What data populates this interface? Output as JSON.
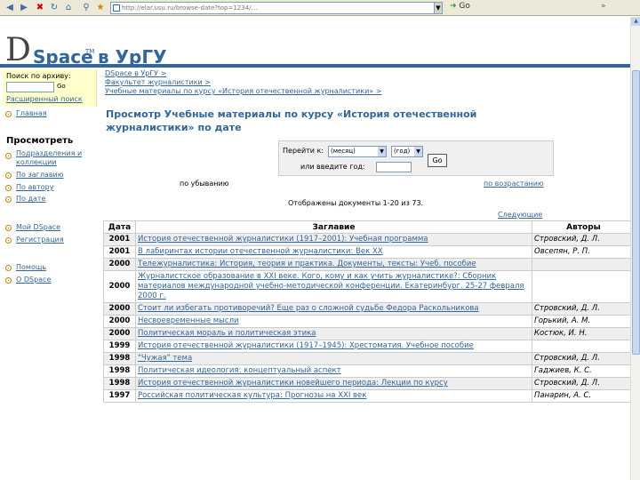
{
  "browser": {
    "address": "http://elar.usu.ru/browse-date?top=1234/…",
    "go_label": "Go"
  },
  "header": {
    "logo_d": "D",
    "logo_space": "Space",
    "logo_tm": "TM",
    "logo_suffix": "в УрГУ"
  },
  "sidebar": {
    "search_label": "Поиск по архиву:",
    "search_go": "Go",
    "advanced": "Расширенный поиск",
    "home": "Главная",
    "browse_heading": "Просмотреть",
    "browse_items": [
      "Подразделения и коллекции",
      "По заглавию",
      "По автору",
      "По дате"
    ],
    "my_items": [
      "Мой DSpace",
      "Регистрация"
    ],
    "help_items": [
      "Помощь",
      "О DSpace"
    ]
  },
  "main": {
    "crumbs": [
      "DSpace в УрГУ >",
      "Факультет журналистики >",
      "Учебные материалы по курсу «История отечественной журналистики» >"
    ],
    "title": "Просмотр Учебные материалы по курсу «История отечественной журналистики» по дате",
    "jump_label": "Перейти к:",
    "month_value": "(месяц)",
    "year_value": "(год)",
    "go_label": "Go",
    "year_prompt": "или введите год:",
    "sort_desc": "по убыванию",
    "sort_asc": "по возрастанию",
    "showing": "Отображены документы 1-20 из 73.",
    "next": "Следующие"
  },
  "table": {
    "headers": [
      "Дата",
      "Заглавие",
      "Авторы"
    ],
    "rows": [
      {
        "date": "2001",
        "title": "История отечественной журналистики (1917–2001): Учебная программа",
        "authors": "Стровский, Д. Л."
      },
      {
        "date": "2001",
        "title": "В лабиринтах истории отечественной журналистики: Век XX",
        "authors": "Овсепян, Р. П."
      },
      {
        "date": "2000",
        "title": "Тележурналистика: История, теория и практика. Документы, тексты: Учеб. пособие",
        "authors": ""
      },
      {
        "date": "2000",
        "title": "Журналистское образование в XXI веке. Кого, кому и как учить журналистике?: Сборник материалов международной учебно-методической конференции. Екатеринбург. 25-27 февраля 2000 г.",
        "authors": ""
      },
      {
        "date": "2000",
        "title": "Стоит ли избегать противоречий? Еще раз о сложной судьбе Федора Раскольникова",
        "authors": "Стровский, Д. Л."
      },
      {
        "date": "2000",
        "title": "Несвоевременные мысли",
        "authors": "Горький, А. М."
      },
      {
        "date": "2000",
        "title": "Политическая мораль и политическая этика",
        "authors": "Костюк, И. Н."
      },
      {
        "date": "1999",
        "title": "История отечественной журналистики (1917–1945): Хрестоматия. Учебное пособие",
        "authors": ""
      },
      {
        "date": "1998",
        "title": "\"Чужая\" тема",
        "authors": "Стровский, Д. Л."
      },
      {
        "date": "1998",
        "title": "Политическая идеология: концептуальный аспект",
        "authors": "Гаджиев, К. С."
      },
      {
        "date": "1998",
        "title": "История отечественной журналистики новейшего периода: Лекции по курсу",
        "authors": "Стровский, Д. Л."
      },
      {
        "date": "1997",
        "title": "Российская политическая культура: Прогнозы на XXI век",
        "authors": "Панарин, А. С."
      }
    ]
  }
}
